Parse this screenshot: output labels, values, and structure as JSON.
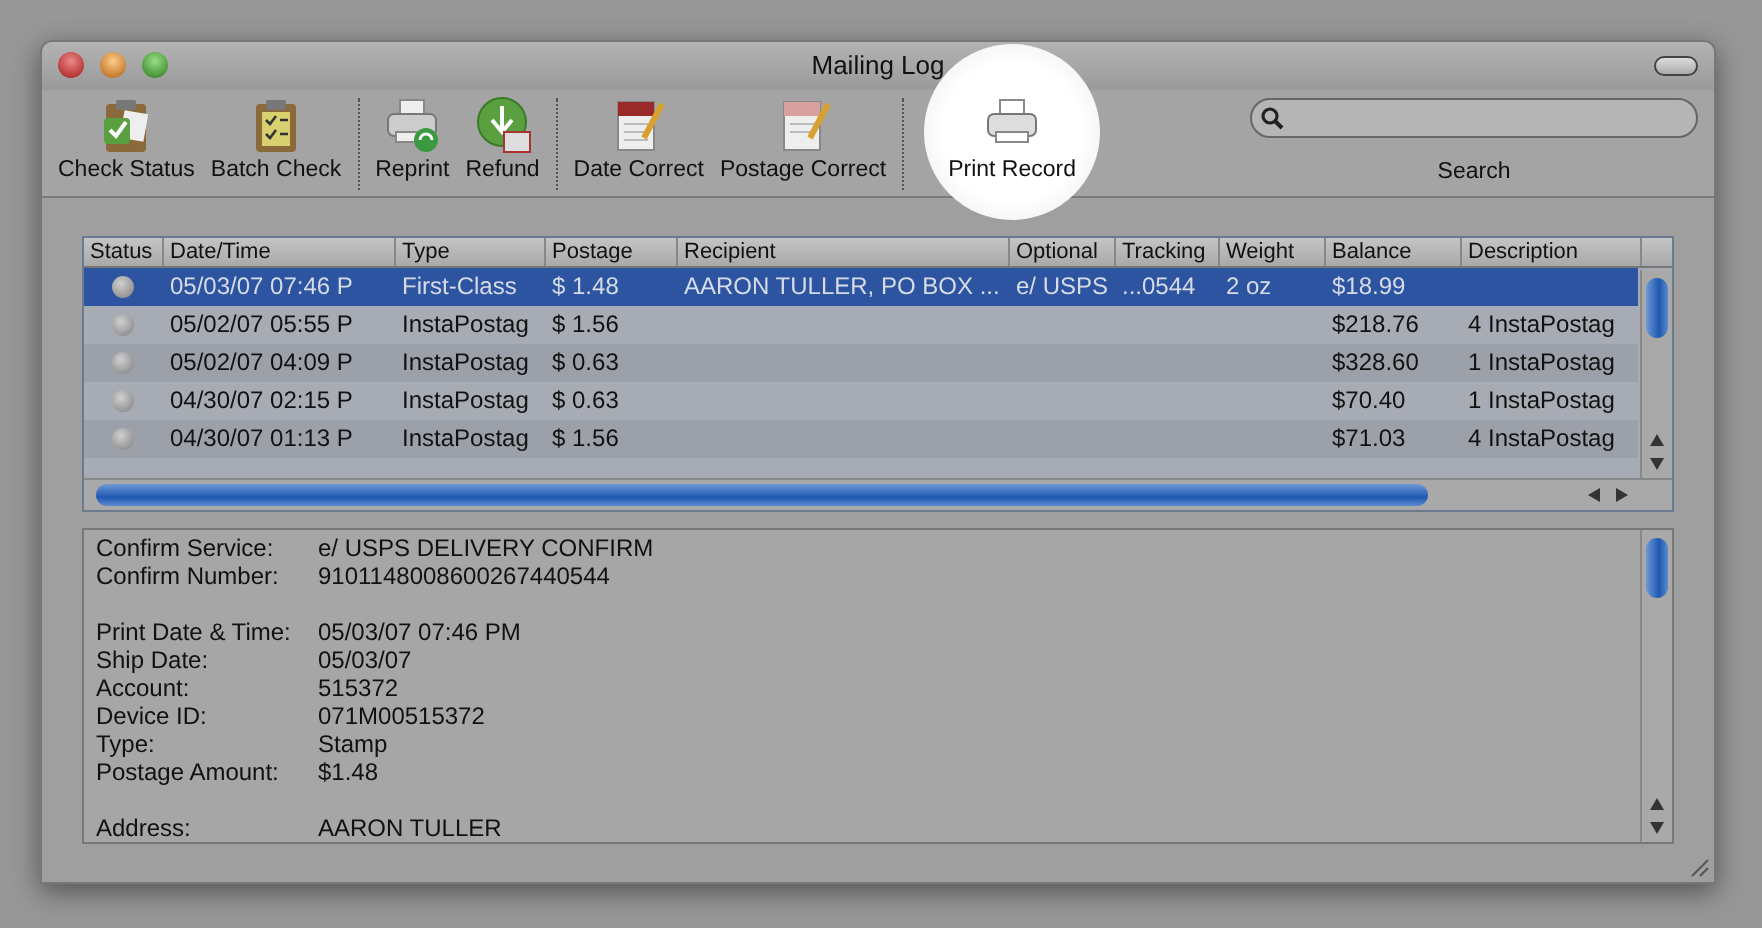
{
  "window": {
    "title": "Mailing Log"
  },
  "toolbar": {
    "groups": [
      [
        {
          "label": "Check Status",
          "highlighted": false
        },
        {
          "label": "Batch Check",
          "highlighted": false
        }
      ],
      [
        {
          "label": "Reprint",
          "highlighted": false
        },
        {
          "label": "Refund",
          "highlighted": false
        }
      ],
      [
        {
          "label": "Date Correct",
          "highlighted": false
        },
        {
          "label": "Postage Correct",
          "highlighted": false
        }
      ],
      [
        {
          "label": "Print Record",
          "highlighted": true
        }
      ]
    ],
    "search": {
      "label": "Search"
    }
  },
  "table": {
    "columns": [
      "Status",
      "Date/Time",
      "Type",
      "Postage",
      "Recipient",
      "Optional",
      "Tracking",
      "Weight",
      "Balance",
      "Description"
    ],
    "rows": [
      {
        "selected": true,
        "date_time": "05/03/07 07:46 P",
        "type": "First-Class",
        "postage": "$ 1.48",
        "recipient": "AARON TULLER, PO BOX ...",
        "optional": "e/ USPS",
        "tracking": "...0544",
        "weight": "2 oz",
        "balance": "$18.99"
      },
      {
        "selected": false,
        "date_time": "05/02/07 05:55 P",
        "type": "InstaPostag",
        "postage": "$ 1.56",
        "balance": "$218.76",
        "description": "4 InstaPostag"
      },
      {
        "selected": false,
        "date_time": "05/02/07 04:09 P",
        "type": "InstaPostag",
        "postage": "$ 0.63",
        "balance": "$328.60",
        "description": "1 InstaPostag"
      },
      {
        "selected": false,
        "date_time": "04/30/07 02:15 P",
        "type": "InstaPostag",
        "postage": "$ 0.63",
        "balance": "$70.40",
        "description": "1 InstaPostag"
      },
      {
        "selected": false,
        "date_time": "04/30/07 01:13 P",
        "type": "InstaPostag",
        "postage": "$ 1.56",
        "balance": "$71.03",
        "description": "4 InstaPostag"
      }
    ]
  },
  "details": {
    "groups": [
      [
        {
          "label": "Confirm Service:",
          "value": "e/ USPS DELIVERY CONFIRM"
        },
        {
          "label": "Confirm Number:",
          "value": "9101148008600267440544"
        }
      ],
      [
        {
          "label": "Print Date & Time:",
          "value": "05/03/07 07:46 PM"
        },
        {
          "label": "Ship Date:",
          "value": "05/03/07"
        },
        {
          "label": "Account:",
          "value": "515372"
        },
        {
          "label": "Device ID:",
          "value": "071M00515372"
        },
        {
          "label": "Type:",
          "value": "Stamp"
        },
        {
          "label": "Postage Amount:",
          "value": "$1.48"
        }
      ],
      [
        {
          "label": "Address:",
          "value": "AARON TULLER"
        }
      ]
    ]
  }
}
